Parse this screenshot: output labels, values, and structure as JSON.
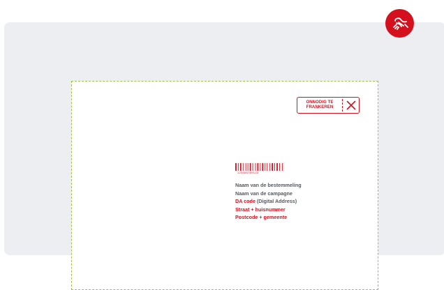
{
  "stamp": {
    "line1": "ONNODIG TE",
    "line2": "FRANKEREN"
  },
  "barcode": {
    "number": "123456789123"
  },
  "address": {
    "recipient": "Naam van de bestemmeling",
    "campaign": "Naam van de campagne",
    "da_code_label": "DA code",
    "da_code_note": "(Digital Address)",
    "street": "Straat + huisnummer",
    "postcode": "Postcode + gemeente"
  },
  "colors": {
    "brand_red": "#d40f1e",
    "panel_bg": "#eceef1",
    "envelope_border": "#9bc24a",
    "text_grey": "#555a5f"
  },
  "icons": {
    "logo": "bpost-horn-logo-icon",
    "stamp_cross": "cross-icon"
  }
}
